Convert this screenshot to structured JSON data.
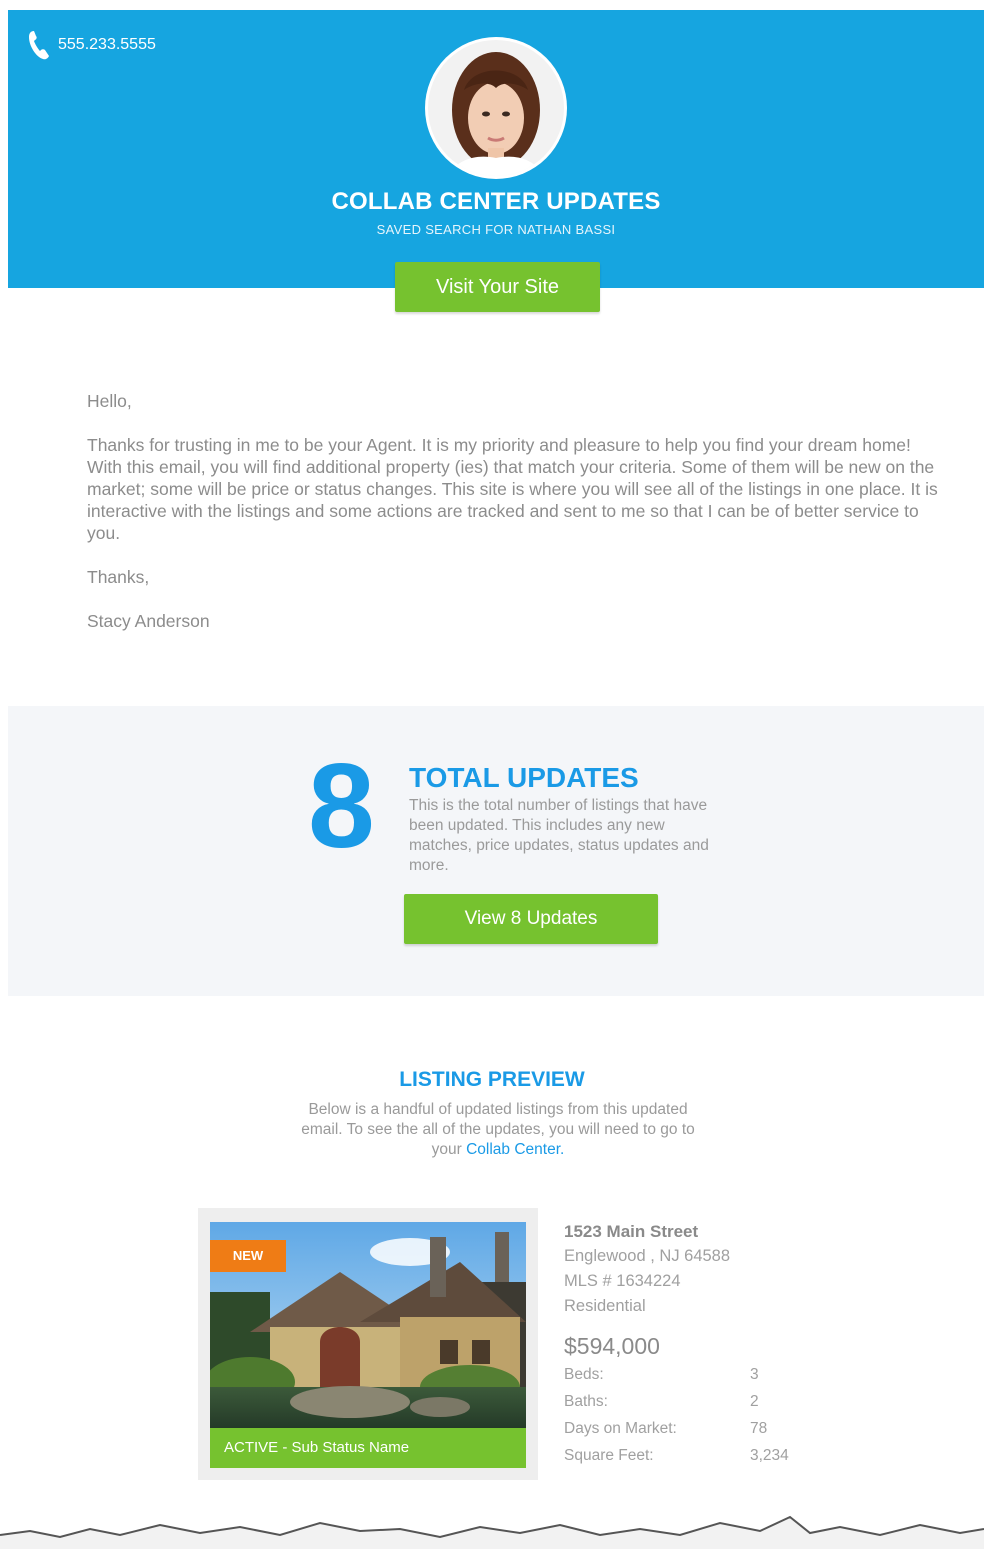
{
  "header": {
    "phone": "555.233.5555",
    "title": "COLLAB CENTER UPDATES",
    "subtitle": "SAVED SEARCH FOR NATHAN BASSI",
    "visit_label": "Visit Your Site",
    "bg_color": "#16a5e0"
  },
  "letter": {
    "greeting": "Hello,",
    "body": "Thanks for trusting in me to be your Agent. It is my priority and pleasure to help you find your dream home! With this email, you will find additional property (ies) that match your criteria. Some of them will be new on the market; some will be price or status changes. This site is where you will see all of the listings in one place. It is interactive with the listings and some actions are tracked and sent to me so that I can be of better service to you.",
    "closing": "Thanks,",
    "signature": "Stacy Anderson"
  },
  "updates": {
    "count": "8",
    "title": "TOTAL UPDATES",
    "description": "This is the total number of listings that have been updated.  This includes any new matches, price updates, status updates and more.",
    "button_label": "View 8 Updates"
  },
  "listing_preview": {
    "title": "LISTING PREVIEW",
    "description": "Below is a handful of updated listings from this updated email.  To see the all of the updates, you will need to go to your",
    "link_label": "Collab Center."
  },
  "listing": {
    "badge": "NEW",
    "status": "ACTIVE - Sub Status Name",
    "street": "1523 Main Street",
    "city_state": "Englewood , NJ 64588",
    "mls": "MLS # 1634224",
    "type": "Residential",
    "price": "$594,000",
    "specs": [
      {
        "label": "Beds:",
        "value": "3"
      },
      {
        "label": "Baths:",
        "value": "2"
      },
      {
        "label": "Days on Market:",
        "value": "78"
      },
      {
        "label": "Square Feet:",
        "value": "3,234"
      }
    ]
  },
  "colors": {
    "accent_blue": "#1a9ae6",
    "button_green": "#76c22f",
    "badge_orange": "#ef7c15"
  },
  "icons": {
    "phone": "phone-icon"
  }
}
